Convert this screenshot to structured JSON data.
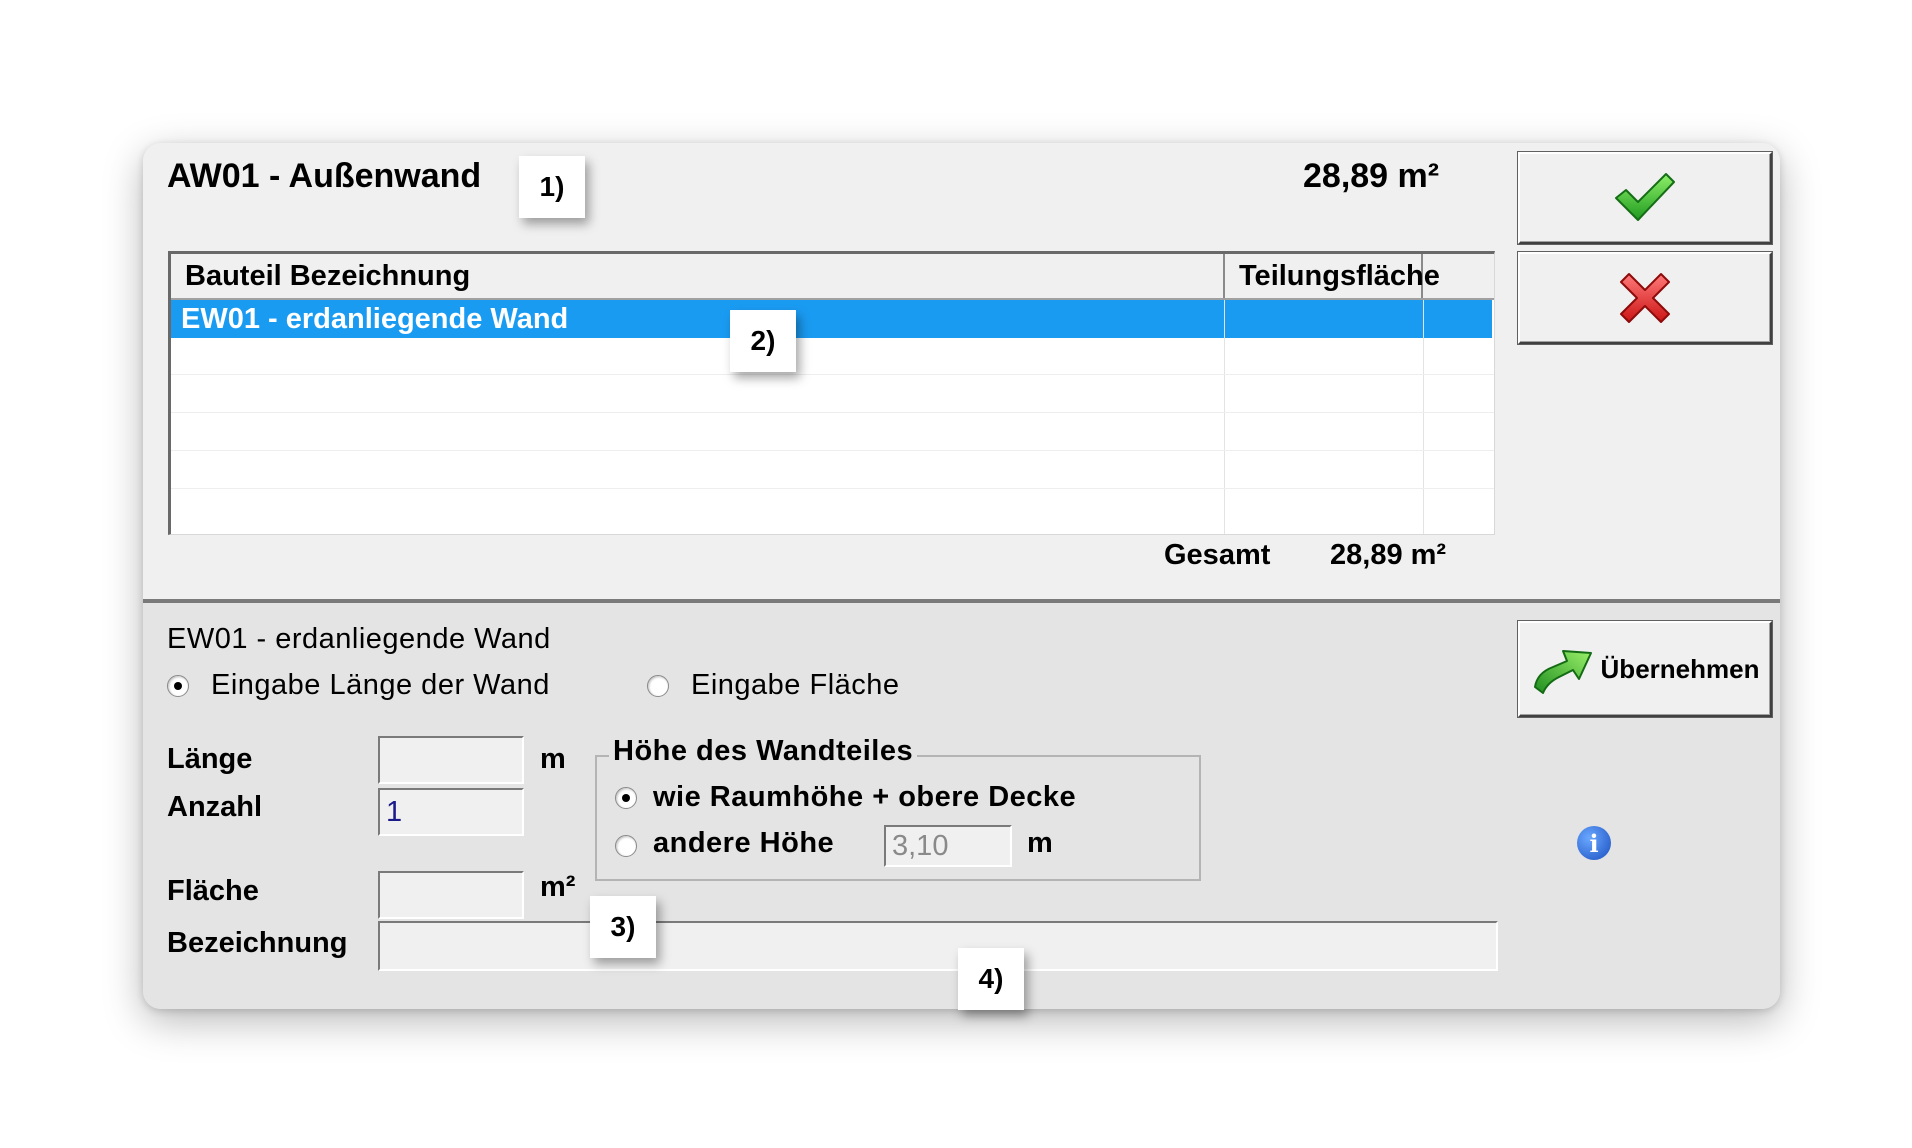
{
  "header": {
    "title": "AW01 - Außenwand",
    "area": "28,89 m²"
  },
  "callouts": [
    "1)",
    "2)",
    "3)",
    "4)"
  ],
  "buttons": {
    "ok_icon": "check-icon",
    "cancel_icon": "cross-icon",
    "apply_label": "Übernehmen",
    "apply_icon": "arrow-icon"
  },
  "table": {
    "columns": [
      "Bauteil Bezeichnung",
      "Teilungsfläche"
    ],
    "rows": [
      {
        "name": "EW01 - erdanliegende Wand",
        "area": ""
      }
    ]
  },
  "summary": {
    "label": "Gesamt",
    "value": "28,89 m²"
  },
  "detail": {
    "title": "EW01 - erdanliegende Wand",
    "mode_length_label": "Eingabe Länge der Wand",
    "mode_area_label": "Eingabe Fläche",
    "selected_mode": "length",
    "length_label": "Länge",
    "length_value": "",
    "length_unit": "m",
    "count_label": "Anzahl",
    "count_value": "1",
    "area_label": "Fläche",
    "area_value": "",
    "area_unit": "m²",
    "name_label": "Bezeichnung",
    "name_value": "",
    "height_group": {
      "legend": "Höhe des Wandteiles",
      "option_room_label": "wie Raumhöhe + obere Decke",
      "option_other_label": "andere Höhe",
      "other_value": "3,10",
      "other_unit": "m",
      "selected": "room"
    }
  },
  "colors": {
    "selection": "#1a9bf2",
    "dialog_bg": "#f0f0f0",
    "bottom_bg": "#e4e4e4"
  }
}
